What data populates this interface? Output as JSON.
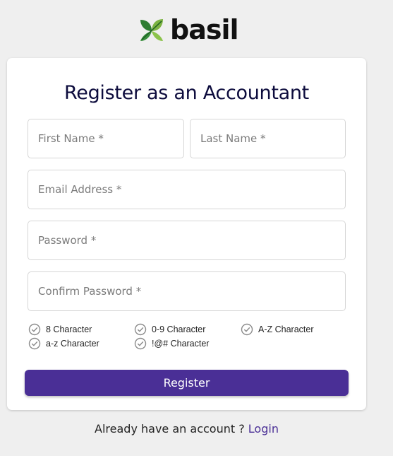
{
  "brand": {
    "name": "basil",
    "logo_icon": "leaf-icon"
  },
  "form": {
    "title": "Register as an Accountant",
    "first_name_placeholder": "First Name *",
    "last_name_placeholder": "Last Name *",
    "email_placeholder": "Email Address *",
    "password_placeholder": "Password *",
    "confirm_password_placeholder": "Confirm Password *",
    "password_rules": [
      "8 Character",
      "0-9 Character",
      "A-Z Character",
      "a-z Character",
      "!@# Character"
    ],
    "submit_label": "Register"
  },
  "footer": {
    "prompt": "Already have an account ?",
    "login_link": "Login"
  },
  "colors": {
    "accent": "#4a2f96",
    "title": "#0d0c3d",
    "background": "#efefef",
    "leaf_dark": "#2e7d32",
    "leaf_light": "#8bc34a"
  }
}
